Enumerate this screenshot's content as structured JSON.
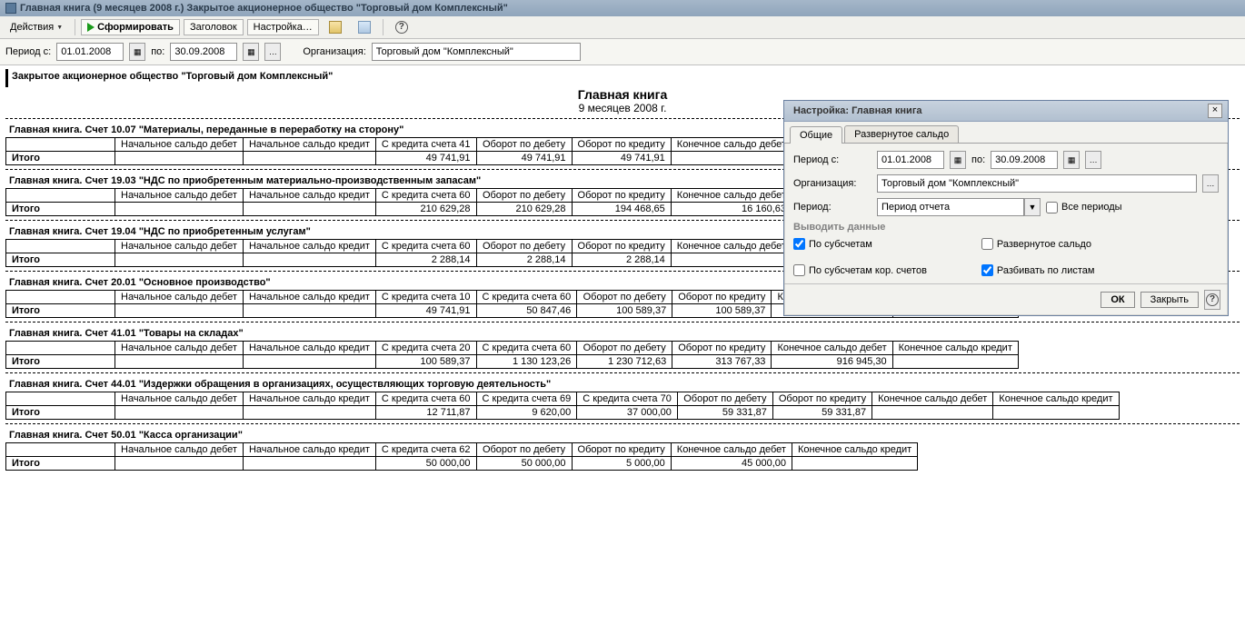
{
  "titlebar": "Главная книга (9 месяцев 2008 г.) Закрытое акционерное общество \"Торговый дом Комплексный\"",
  "toolbar": {
    "actions": "Действия",
    "form": "Сформировать",
    "header": "Заголовок",
    "settings": "Настройка…"
  },
  "params": {
    "period_from_label": "Период с:",
    "period_from": "01.01.2008",
    "period_to_label": "по:",
    "period_to": "30.09.2008",
    "org_label": "Организация:",
    "org": "Торговый дом \"Комплексный\""
  },
  "report": {
    "company": "Закрытое акционерное общество \"Торговый дом Комплексный\"",
    "title": "Главная книга",
    "subtitle": "9 месяцев 2008 г.",
    "total_label": "Итого",
    "std_headers": {
      "nsb": "Начальное сальдо дебет",
      "nsk": "Начальное сальдо кредит",
      "obd": "Оборот по дебету",
      "obk": "Оборот по кредиту",
      "ksd": "Конечное сальдо дебет",
      "ksk": "Конечное сальдо кредит"
    }
  },
  "sec1": {
    "title": "Главная книга. Счет 10.07 \"Материалы, переданные в переработку на сторону\"",
    "c3": "С кредита счета 41",
    "v3": "49 741,91",
    "v4": "49 741,91",
    "v5": "49 741,91"
  },
  "sec2": {
    "title": "Главная книга. Счет 19.03 \"НДС по приобретенным материально-производственным запасам\"",
    "c3": "С кредита счета 60",
    "v3": "210 629,28",
    "v4": "210 629,28",
    "v5": "194 468,65",
    "v6": "16 160,63"
  },
  "sec3": {
    "title": "Главная книга. Счет 19.04 \"НДС по приобретенным услугам\"",
    "c3": "С кредита счета 60",
    "v3": "2 288,14",
    "v4": "2 288,14",
    "v5": "2 288,14"
  },
  "sec4": {
    "title": "Главная книга. Счет 20.01 \"Основное производство\"",
    "c3": "С кредита счета 10",
    "c4": "С кредита счета 60",
    "v3": "49 741,91",
    "v4": "50 847,46",
    "v5": "100 589,37",
    "v6": "100 589,37"
  },
  "sec5": {
    "title": "Главная книга. Счет 41.01 \"Товары на складах\"",
    "c3": "С кредита счета 20",
    "c4": "С кредита счета 60",
    "v3": "100 589,37",
    "v4": "1 130 123,26",
    "v5": "1 230 712,63",
    "v6": "313 767,33",
    "v7": "916 945,30"
  },
  "sec6": {
    "title": "Главная книга. Счет 44.01 \"Издержки обращения в организациях, осуществляющих торговую деятельность\"",
    "c3": "С кредита счета 60",
    "c4": "С кредита счета 69",
    "c5": "С кредита счета 70",
    "v3": "12 711,87",
    "v4": "9 620,00",
    "v5": "37 000,00",
    "v6": "59 331,87",
    "v7": "59 331,87"
  },
  "sec7": {
    "title": "Главная книга. Счет 50.01 \"Касса организации\"",
    "c3": "С кредита счета 62",
    "v3": "50 000,00",
    "v4": "50 000,00",
    "v5": "5 000,00",
    "v6": "45 000,00"
  },
  "dialog": {
    "title": "Настройка: Главная книга",
    "tab1": "Общие",
    "tab2": "Развернутое сальдо",
    "period_from_label": "Период с:",
    "period_from": "01.01.2008",
    "period_to_label": "по:",
    "period_to": "30.09.2008",
    "org_label": "Организация:",
    "org": "Торговый дом \"Комплексный\"",
    "period_label": "Период:",
    "period_combo": "Период отчета",
    "all_periods": "Все периоды",
    "output_section": "Выводить данные",
    "by_sub": "По субсчетам",
    "expanded": "Развернутое сальдо",
    "by_sub_kor": "По субсчетам кор. счетов",
    "split_sheets": "Разбивать по листам",
    "ok": "ОК",
    "close": "Закрыть"
  }
}
